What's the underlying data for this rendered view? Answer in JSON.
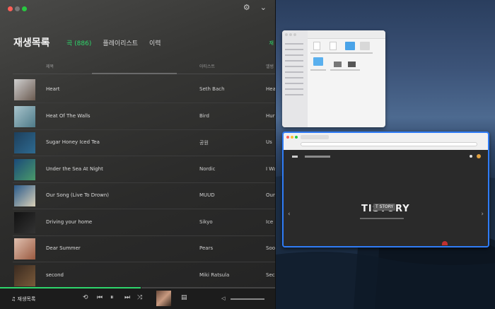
{
  "music": {
    "title": "재생목록",
    "tabs": [
      {
        "label": "곡 (886)",
        "active": true
      },
      {
        "label": "플레이리스트",
        "active": false
      },
      {
        "label": "이력",
        "active": false
      }
    ],
    "edge_label": "재",
    "columns": {
      "song": "제목",
      "artist": "아티스트",
      "album": "앨범"
    },
    "rows": [
      {
        "song": "Heart",
        "artist": "Seth Bach",
        "album": "Hea",
        "thumb": [
          "#cfcfcf",
          "#6a5a50"
        ]
      },
      {
        "song": "Heat Of The Walls",
        "artist": "Bird",
        "album": "Hur",
        "thumb": [
          "#a8c4cc",
          "#4e7a88"
        ]
      },
      {
        "song": "Sugar Honey Iced Tea",
        "artist": "공원",
        "album": "Us",
        "thumb": [
          "#1d3f5c",
          "#2e6a90"
        ]
      },
      {
        "song": "Under the Sea At Night",
        "artist": "Nordic",
        "album": "I Wa",
        "thumb": [
          "#1a4a7a",
          "#4a9a6a"
        ]
      },
      {
        "song": "Our Song (Live To Drown)",
        "artist": "MUUD",
        "album": "Our",
        "thumb": [
          "#2a5a8a",
          "#d8d0b8"
        ]
      },
      {
        "song": "Driving your home",
        "artist": "Sikyo",
        "album": "Ice",
        "thumb": [
          "#111111",
          "#333333"
        ]
      },
      {
        "song": "Dear Summer",
        "artist": "Pears",
        "album": "Soo",
        "thumb": [
          "#e0c0b0",
          "#9a5a40"
        ]
      },
      {
        "song": "second",
        "artist": "Miki Ratsula",
        "album": "Sec",
        "thumb": [
          "#3a2a20",
          "#7a5a3a"
        ]
      }
    ],
    "player": {
      "label": "재생목록",
      "icons": [
        "repeat-icon",
        "prev-icon",
        "pause-icon",
        "next-icon",
        "shuffle-icon",
        "lyrics-icon",
        "volume-icon"
      ]
    },
    "progress": 0.51
  },
  "browser": {
    "logo": "TISTORY",
    "badge": "T STORY"
  },
  "colors": {
    "accent": "#2ed66b",
    "focus": "#2f7cf6"
  }
}
